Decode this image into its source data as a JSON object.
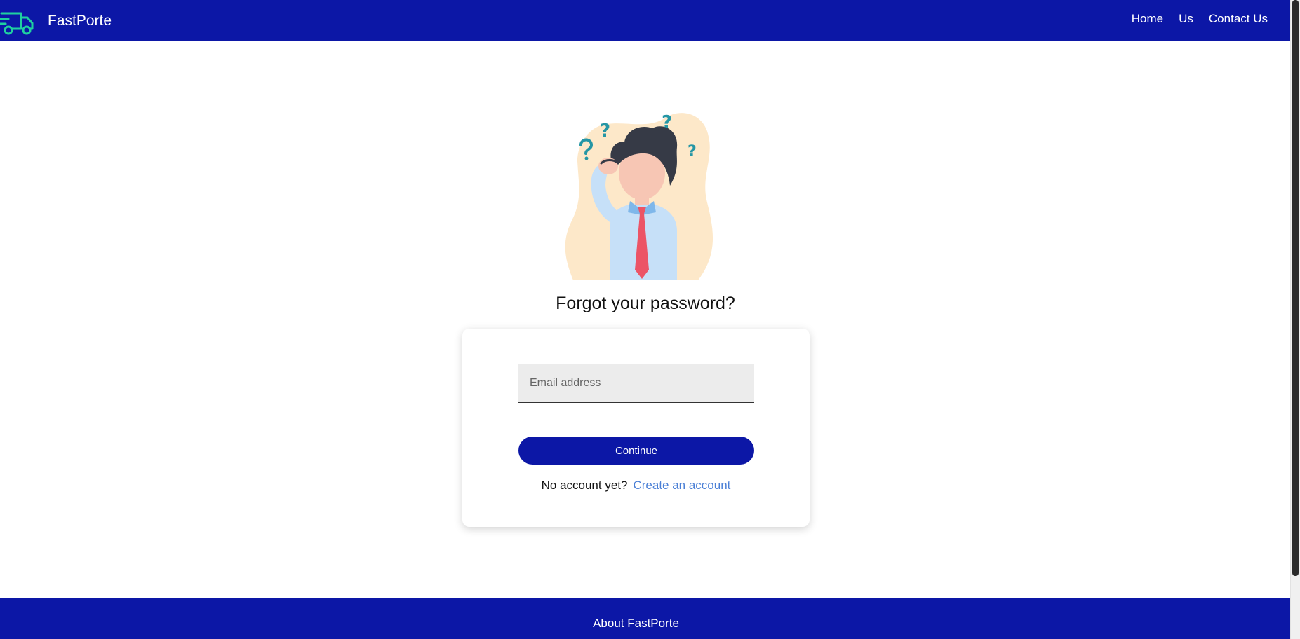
{
  "header": {
    "brand": "FastPorte",
    "nav": [
      "Home",
      "Us",
      "Contact Us"
    ]
  },
  "main": {
    "title": "Forgot your password?",
    "email_placeholder": "Email address",
    "continue_label": "Continue",
    "no_account_text": "No account yet?",
    "create_account_label": "Create an account"
  },
  "footer": {
    "about": "About FastPorte"
  },
  "icons": {
    "brand_icon": "truck-icon",
    "illustration": "confused-person-illustration"
  },
  "colors": {
    "primary": "#0c17a6",
    "accent_icon": "#1fd0a0",
    "link": "#4a7fd6"
  }
}
